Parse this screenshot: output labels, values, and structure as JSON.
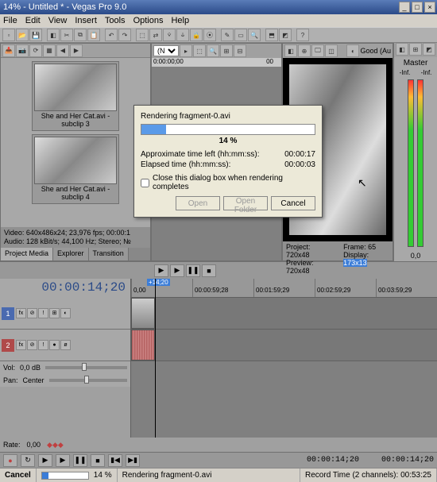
{
  "window": {
    "title": "14% - Untitled * - Vegas Pro 9.0"
  },
  "menu": [
    "File",
    "Edit",
    "View",
    "Insert",
    "Tools",
    "Options",
    "Help"
  ],
  "clips": [
    {
      "name": "She and Her Cat.avi - subclip 3"
    },
    {
      "name": "She and Her Cat.avi - subclip 4"
    }
  ],
  "project_info": {
    "video": "Video: 640x486x24; 23,976 fps; 00:00:1",
    "audio": "Audio: 128 kBit/s; 44,100 Hz; Stereo; №"
  },
  "pm_tabs": {
    "active": "Project Media",
    "others": [
      "Explorer",
      "Transition"
    ]
  },
  "trimmer": {
    "dropdown_label": "(N",
    "time0": "0:00:00;00",
    "time1": "00"
  },
  "preview": {
    "quality": "Good (Au",
    "proj_label": "Project:",
    "proj_val": "720x48",
    "frame_label": "Frame:",
    "frame_val": "65",
    "prev_label": "Preview:",
    "prev_val": "720x48",
    "disp_label": "Display:",
    "disp_val": "173x13"
  },
  "master": {
    "label": "Master",
    "inf1": "-Inf.",
    "inf2": "-Inf.",
    "bottom": "0,0"
  },
  "timeline": {
    "bigtime": "00:00:14;20",
    "marker": "+14;20",
    "ticks": [
      "0,00",
      "00:00:59;28",
      "00:01:59;29",
      "00:02:59;29",
      "00:03:59;29"
    ],
    "track1_num": "1",
    "track2_num": "2",
    "vol_label": "Vol:",
    "vol_val": "0,0 dB",
    "pan_label": "Pan:",
    "pan_val": "Center"
  },
  "rate": {
    "label": "Rate:",
    "val": "0,00"
  },
  "bottom_times": {
    "a": "00:00:14;20",
    "b": "00:00:14;20"
  },
  "status": {
    "cancel": "Cancel",
    "pct": "14 %",
    "file": "Rendering fragment-0.avi",
    "rec": "Record Time (2 channels): 00:53:25"
  },
  "dialog": {
    "rendering": "Rendering fragment-0.avi",
    "pct": "14 %",
    "approx_lbl": "Approximate time left (hh:mm:ss):",
    "approx_val": "00:00:17",
    "elapsed_lbl": "Elapsed time (hh:mm:ss):",
    "elapsed_val": "00:00:03",
    "checkbox": "Close this dialog box when rendering completes",
    "open": "Open",
    "openf": "Open Folder",
    "cancel": "Cancel"
  }
}
